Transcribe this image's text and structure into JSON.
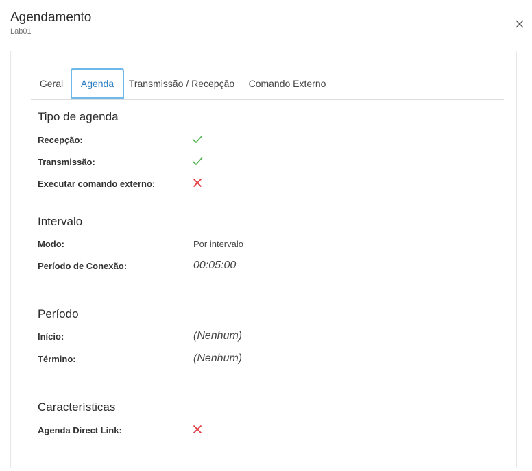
{
  "header": {
    "title": "Agendamento",
    "subtitle": "Lab01"
  },
  "tabs": [
    {
      "label": "Geral",
      "active": false
    },
    {
      "label": "Agenda",
      "active": true
    },
    {
      "label": "Transmissão / Recepção",
      "active": false
    },
    {
      "label": "Comando Externo",
      "active": false
    }
  ],
  "tipo_agenda": {
    "title": "Tipo de agenda",
    "rows": [
      {
        "label": "Recepção:",
        "icon": "check-icon"
      },
      {
        "label": "Transmissão:",
        "icon": "check-icon"
      },
      {
        "label": "Executar comando externo:",
        "icon": "x-icon"
      }
    ]
  },
  "intervalo": {
    "title": "Intervalo",
    "modo_label": "Modo:",
    "modo_value": "Por intervalo",
    "periodo_label": "Período de Conexão:",
    "periodo_value": "00:05:00"
  },
  "periodo": {
    "title": "Período",
    "inicio_label": "Início:",
    "inicio_value": "(Nenhum)",
    "termino_label": "Término:",
    "termino_value": "(Nenhum)"
  },
  "caracteristicas": {
    "title": "Características",
    "direct_link_label": "Agenda Direct Link:",
    "direct_link_icon": "x-icon"
  },
  "colors": {
    "check": "#4cb24c",
    "cross": "#e0393e",
    "accent": "#6fb8ea"
  }
}
